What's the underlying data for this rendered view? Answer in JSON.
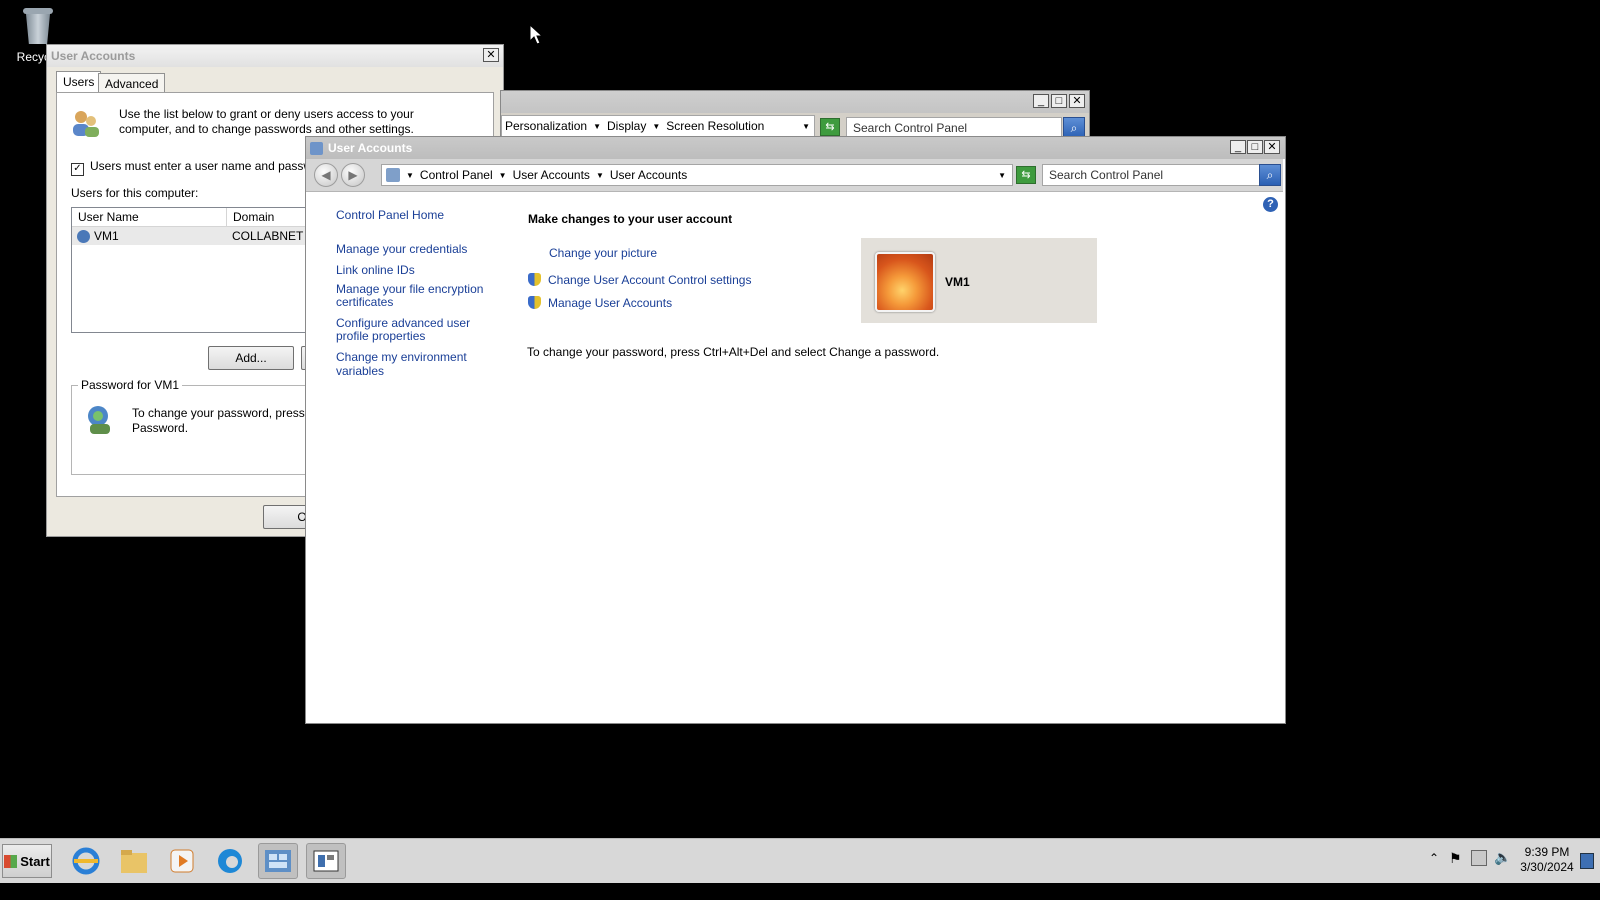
{
  "desktop": {
    "recycle_bin_label": "Recycle"
  },
  "users_dialog": {
    "title": "User Accounts",
    "tabs": [
      "Users",
      "Advanced"
    ],
    "intro_text": "Use the list below to grant or deny users access to your computer, and to change passwords and other settings.",
    "checkbox_label": "Users must enter a user name and passwo",
    "checkbox_checked_mark": "✓",
    "users_heading": "Users for this computer:",
    "columns": [
      "User Name",
      "Domain"
    ],
    "rows": [
      {
        "user": "VM1",
        "domain": "COLLABNET"
      }
    ],
    "add_button": "Add...",
    "password_group": "Password for VM1",
    "password_text": "To change your password, press C Password.",
    "ok_button": "OK"
  },
  "display_window": {
    "breadcrumb": [
      "Personalization",
      "Display",
      "Screen Resolution"
    ],
    "search_placeholder": "Search Control Panel"
  },
  "cp_window": {
    "title": "User Accounts",
    "breadcrumb": [
      "Control Panel",
      "User Accounts",
      "User Accounts"
    ],
    "search_placeholder": "Search Control Panel",
    "sidebar": {
      "home": "Control Panel Home",
      "links": [
        "Manage your credentials",
        "Link online IDs",
        "Manage your file encryption certificates",
        "Configure advanced user profile properties",
        "Change my environment variables"
      ]
    },
    "main": {
      "heading": "Make changes to your user account",
      "change_picture": "Change your picture",
      "uac_settings": "Change User Account Control settings",
      "manage_accounts": "Manage User Accounts",
      "account_name": "VM1",
      "password_note": "To change your password, press Ctrl+Alt+Del and select Change a password."
    }
  },
  "taskbar": {
    "start_label": "Start",
    "time": "9:39 PM",
    "date": "3/30/2024",
    "icons": [
      "internet-explorer-icon",
      "file-explorer-icon",
      "media-player-icon",
      "edge-icon",
      "control-panel-icon",
      "display-settings-icon"
    ]
  },
  "colors": {
    "link": "#1a3f97",
    "desktop": "#000000",
    "taskbar": "#d8d8d8"
  }
}
